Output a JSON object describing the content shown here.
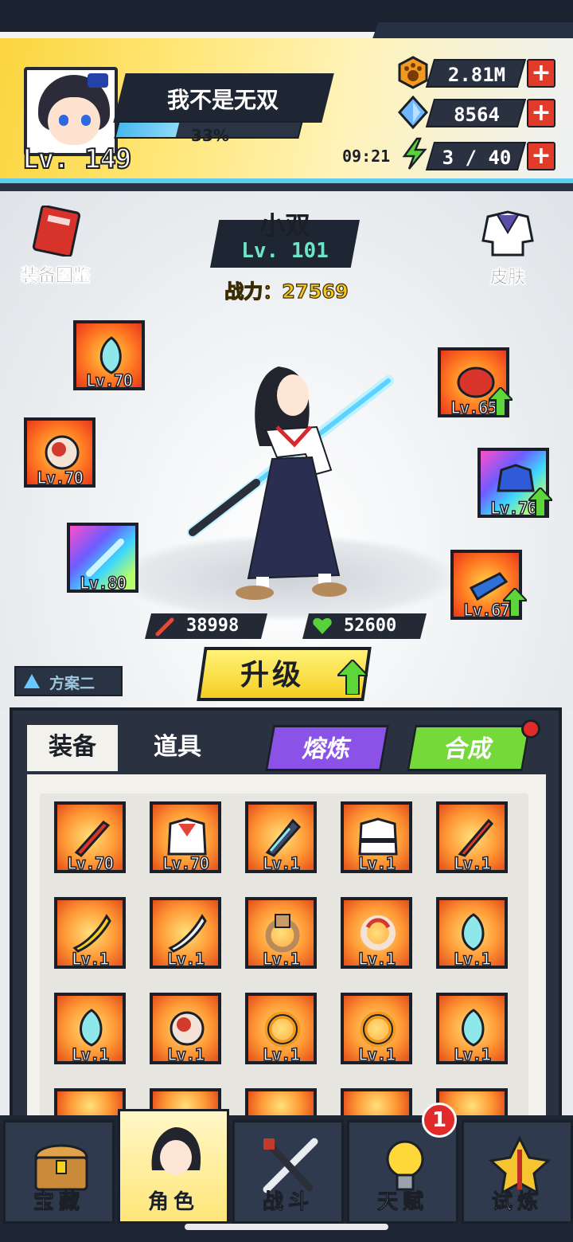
{
  "player": {
    "name": "我不是无双",
    "level": "Lv. 149",
    "exp_percent": "33%",
    "exp_fraction": 0.33
  },
  "resources": {
    "gold": "2.81M",
    "diamonds": "8564",
    "energy_timer": "09:21",
    "energy": "3 / 40"
  },
  "side_buttons": {
    "codex": "装备图鉴",
    "skin": "皮肤"
  },
  "hero": {
    "name": "小双",
    "level": "Lv. 101",
    "power": "战力：27569",
    "attack": "38998",
    "hp": "52600"
  },
  "equipped": [
    {
      "level": "Lv.70",
      "icon": "charm-icon"
    },
    {
      "level": "Lv.70",
      "icon": "ring-icon"
    },
    {
      "level": "Lv.80",
      "icon": "lightsaber-icon"
    },
    {
      "level": "Lv.65",
      "icon": "belt-icon"
    },
    {
      "level": "Lv.76",
      "icon": "blue-armor-icon"
    },
    {
      "level": "Lv.67",
      "icon": "blue-boots-icon"
    }
  ],
  "plan_button": "方案二",
  "upgrade_button": "升级",
  "tabs": {
    "equipment": "装备",
    "items": "道具",
    "smelt": "熔炼",
    "synth": "合成"
  },
  "inventory": [
    {
      "level": "Lv.70",
      "icon": "red-sword-icon"
    },
    {
      "level": "Lv.70",
      "icon": "sailor-uniform-icon"
    },
    {
      "level": "Lv.1",
      "icon": "dark-blade-icon"
    },
    {
      "level": "Lv.1",
      "icon": "karate-gi-icon"
    },
    {
      "level": "Lv.1",
      "icon": "red-blade-icon"
    },
    {
      "level": "Lv.1",
      "icon": "golden-blade-icon"
    },
    {
      "level": "Lv.1",
      "icon": "silver-blade-icon"
    },
    {
      "level": "Lv.1",
      "icon": "bronze-ring-icon"
    },
    {
      "level": "Lv.1",
      "icon": "red-ring-icon"
    },
    {
      "level": "Lv.1",
      "icon": "charm-icon"
    },
    {
      "level": "Lv.1",
      "icon": "charm-icon"
    },
    {
      "level": "Lv.1",
      "icon": "ring-icon"
    },
    {
      "level": "Lv.1",
      "icon": "dragon-ring-icon"
    },
    {
      "level": "Lv.1",
      "icon": "dragon-ring-icon"
    },
    {
      "level": "Lv.1",
      "icon": "charm-icon"
    }
  ],
  "nav": {
    "treasure": "宝藏",
    "character": "角色",
    "battle": "战斗",
    "talent": "天赋",
    "trial": "试炼",
    "talent_badge": "1"
  },
  "colors": {
    "accent_yellow": "#f5d021",
    "panel_dark": "#2a3241",
    "smelt_purple": "#8a52e6",
    "synth_green": "#75d93a"
  }
}
